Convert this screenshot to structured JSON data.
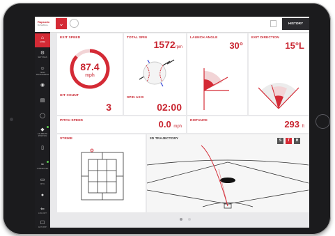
{
  "app": {
    "logo_line1": "Rapsodo",
    "logo_line2": "BASEBALL",
    "history_label": "HISTORY"
  },
  "sidebar": {
    "items": [
      {
        "icon": "⌂",
        "label": "HOME",
        "active": true
      },
      {
        "icon": "⚙",
        "label": "SETTINGS"
      },
      {
        "icon": "☺",
        "label": "TEAM MANAGEMENT"
      },
      {
        "icon": "◉",
        "label": ""
      },
      {
        "icon": "▤",
        "label": ""
      },
      {
        "icon": "◯",
        "label": ""
      },
      {
        "icon": "◆",
        "label": "CALIBRATE POSITION"
      },
      {
        "icon": "▯",
        "label": ""
      },
      {
        "icon": "≈",
        "label": "CONNECTED"
      },
      {
        "icon": "▭",
        "label": "98 %"
      },
      {
        "icon": "●",
        "label": ""
      },
      {
        "icon": "⇐",
        "label": "LOG OUT"
      },
      {
        "icon": "☐",
        "label": "EXIT APP"
      }
    ]
  },
  "metrics": {
    "exit_speed": {
      "title": "EXIT SPEED",
      "value": "87.4",
      "unit": "mph",
      "fill": 0.87
    },
    "hit_count": {
      "title": "HIT COUNT",
      "value": "3"
    },
    "total_spin": {
      "title": "TOTAL SPIN",
      "value": "1572",
      "unit": "rpm"
    },
    "spin_axis": {
      "title": "SPIN AXIS",
      "value": "02:00"
    },
    "launch_angle": {
      "title": "LAUNCH ANGLE",
      "value": "30°"
    },
    "exit_direction": {
      "title": "EXIT DIRECTION",
      "value": "15°L"
    },
    "pitch_speed": {
      "title": "PITCH SPEED",
      "value": "0.0",
      "unit": "mph"
    },
    "distance": {
      "title": "DISTANCE",
      "value": "293",
      "unit": "ft"
    },
    "strike": {
      "title": "STRIKE"
    },
    "trajectory": {
      "title": "3D TRAJECTORY",
      "toggles": [
        "S",
        "T",
        "H"
      ],
      "active_toggle": "T"
    }
  },
  "colors": {
    "accent": "#d42a35",
    "sidebar": "#1d1d20"
  },
  "pager": {
    "pages": 2,
    "current": 1
  }
}
